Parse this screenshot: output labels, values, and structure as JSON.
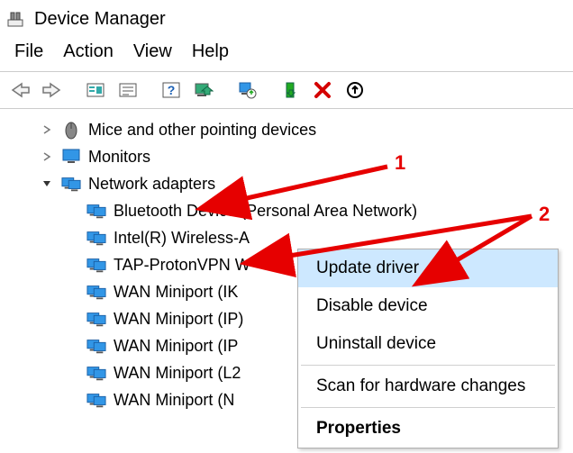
{
  "window": {
    "title": "Device Manager"
  },
  "menu": {
    "file": "File",
    "action": "Action",
    "view": "View",
    "help": "Help"
  },
  "tree": {
    "mice": "Mice and other pointing devices",
    "monitors": "Monitors",
    "network": "Network adapters",
    "children": {
      "bt": "Bluetooth Device (Personal Area Network)",
      "wifi": "Intel(R) Wireless-A",
      "tap": "TAP-ProtonVPN W",
      "ike": "WAN Miniport (IK",
      "ip": "WAN Miniport (IP)",
      "ipv": "WAN Miniport (IP",
      "l2": "WAN Miniport (L2",
      "net": "WAN Miniport (N"
    }
  },
  "context_menu": {
    "update": "Update driver",
    "disable": "Disable device",
    "uninstall": "Uninstall device",
    "scan": "Scan for hardware changes",
    "properties": "Properties"
  },
  "annotations": {
    "label1": "1",
    "label2": "2"
  }
}
